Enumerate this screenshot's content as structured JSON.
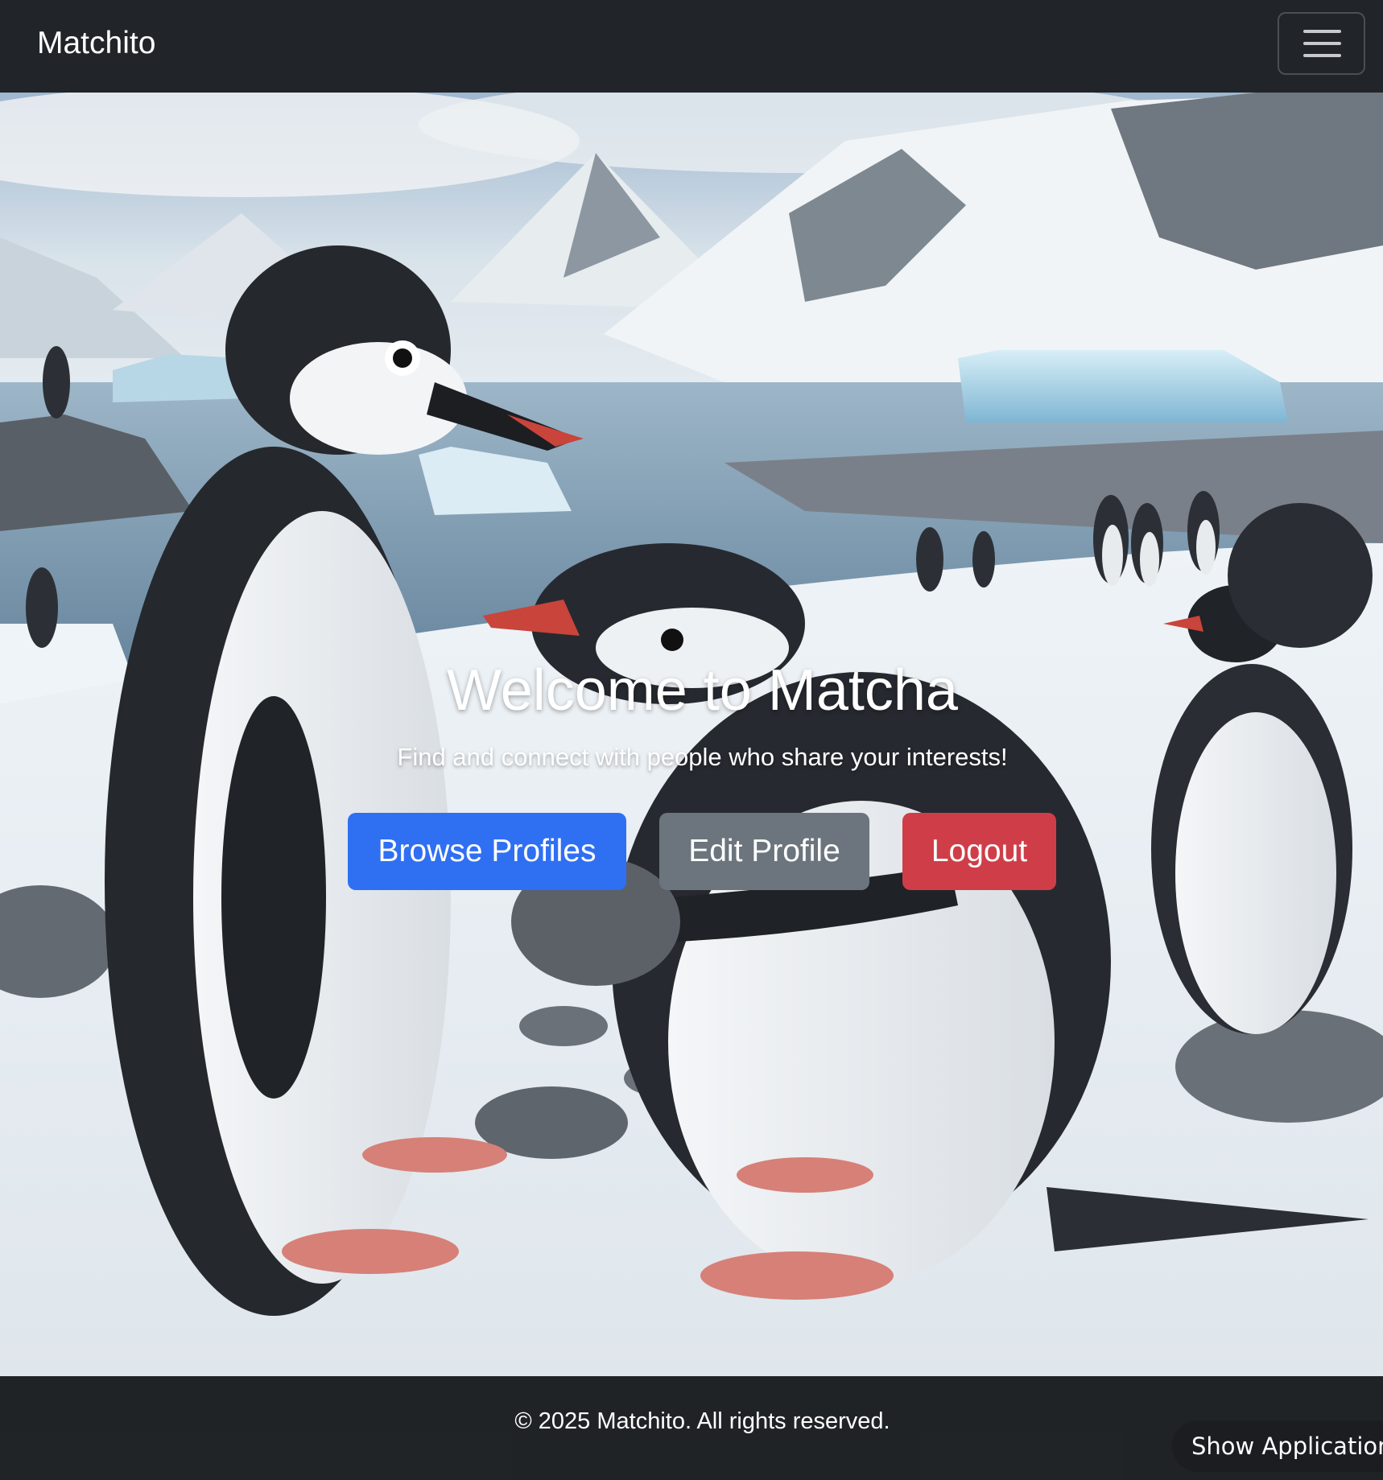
{
  "navbar": {
    "brand": "Matchito",
    "toggler_icon": "hamburger-menu-icon"
  },
  "hero": {
    "title": "Welcome to Matcha",
    "subtitle": "Find and connect with people who share your interests!",
    "buttons": {
      "browse": "Browse Profiles",
      "edit": "Edit Profile",
      "logout": "Logout"
    },
    "background_image": "antarctic-penguins-illustration"
  },
  "footer": {
    "copyright": "© 2025 Matchito. All rights reserved."
  },
  "overlay": {
    "show_applications": "Show Applications"
  },
  "colors": {
    "navbar": "#212529",
    "primary": "#2f6ff2",
    "secondary": "#6c757d",
    "danger": "#cf3e48"
  }
}
